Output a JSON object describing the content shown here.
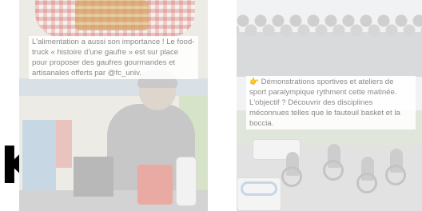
{
  "carousel": {
    "prev_glyph": "K"
  },
  "post_left": {
    "caption": "L'alimentation a aussi son importance ! Le food-truck « histoire d'une gaufre » est sur place pour proposer des gaufres gourmandes et artisanales offerts par @fc_univ."
  },
  "post_right": {
    "caption_icon": "pointing-hand-icon",
    "caption_icon_glyph": "👉",
    "caption": "Démonstrations sportives et ateliers de sport paralympique rythment cette matinée. L'objectif ? Découvrir des disciplines méconnues telles que le fauteuil basket et la boccia."
  },
  "colors": {
    "caption_text": "#8a8a8a",
    "caption_bg": "#ffffff"
  }
}
